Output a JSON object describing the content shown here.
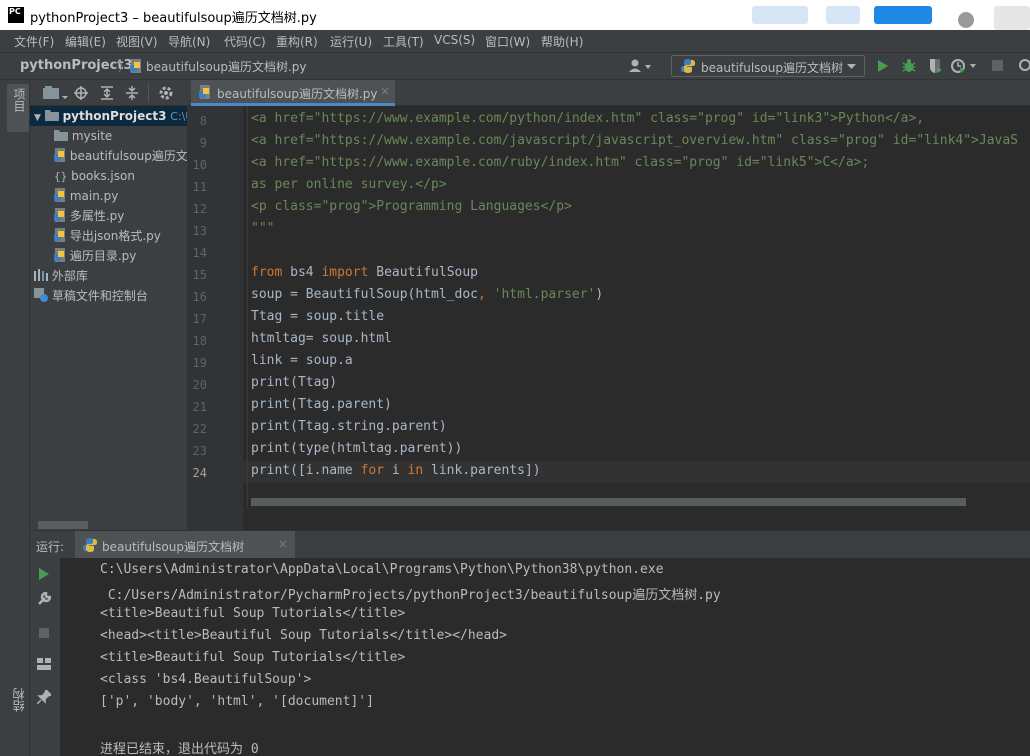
{
  "window": {
    "title": "pythonProject3 – beautifulsoup遍历文档树.py"
  },
  "menu": [
    "文件(F)",
    "编辑(E)",
    "视图(V)",
    "导航(N)",
    "代码(C)",
    "重构(R)",
    "运行(U)",
    "工具(T)",
    "VCS(S)",
    "窗口(W)",
    "帮助(H)"
  ],
  "breadcrumb": {
    "project": "pythonProject3",
    "file": "beautifulsoup遍历文档树.py"
  },
  "run_config": {
    "label": "beautifulsoup遍历文档树"
  },
  "side_tabs": {
    "project": "项目",
    "structure": "结构"
  },
  "project_tree": {
    "root": "pythonProject3",
    "root_path": "C:\\Us",
    "items": [
      "mysite",
      "beautifulsoup遍历文",
      "books.json",
      "main.py",
      "多属性.py",
      "导出json格式.py",
      "遍历目录.py"
    ],
    "external": "外部库",
    "scratches": "草稿文件和控制台"
  },
  "editor": {
    "tab_label": "beautifulsoup遍历文档树.py",
    "line_numbers": [
      "8",
      "9",
      "10",
      "11",
      "12",
      "13",
      "14",
      "15",
      "16",
      "17",
      "18",
      "19",
      "20",
      "21",
      "22",
      "23",
      "24"
    ],
    "lines": [
      "<a href=\"https://www.example.com/python/index.htm\" class=\"prog\" id=\"link3\">Python</a>,",
      "<a href=\"https://www.example.com/javascript/javascript_overview.htm\" class=\"prog\" id=\"link4\">JavaS",
      "<a href=\"https://www.example.com/ruby/index.htm\" class=\"prog\" id=\"link5\">C</a>;",
      "as per online survey.</p>",
      "<p class=\"prog\">Programming Languages</p>",
      "\"\"\"",
      "",
      "from bs4 import BeautifulSoup",
      "soup = BeautifulSoup(html_doc, 'html.parser')",
      "Ttag = soup.title",
      "htmltag= soup.html",
      "link = soup.a",
      "print(Ttag)",
      "print(Ttag.parent)",
      "print(Ttag.string.parent)",
      "print(type(htmltag.parent))",
      "print([i.name for i in link.parents])"
    ]
  },
  "run_panel": {
    "label": "运行:",
    "tab_label": "beautifulsoup遍历文档树",
    "output": [
      "C:\\Users\\Administrator\\AppData\\Local\\Programs\\Python\\Python38\\python.exe",
      " C:/Users/Administrator/PycharmProjects/pythonProject3/beautifulsoup遍历文档树.py",
      "<title>Beautiful Soup Tutorials</title>",
      "<head><title>Beautiful Soup Tutorials</title></head>",
      "<title>Beautiful Soup Tutorials</title>",
      "<class 'bs4.BeautifulSoup'>",
      "['p', 'body', 'html', '[document]']",
      "",
      "进程已结束，退出代码为 0"
    ]
  },
  "colors": {
    "accent": "#4a88c7",
    "run_green": "#499c54",
    "string": "#6a8759",
    "keyword": "#cc7832",
    "tag": "#e8bf6a"
  }
}
